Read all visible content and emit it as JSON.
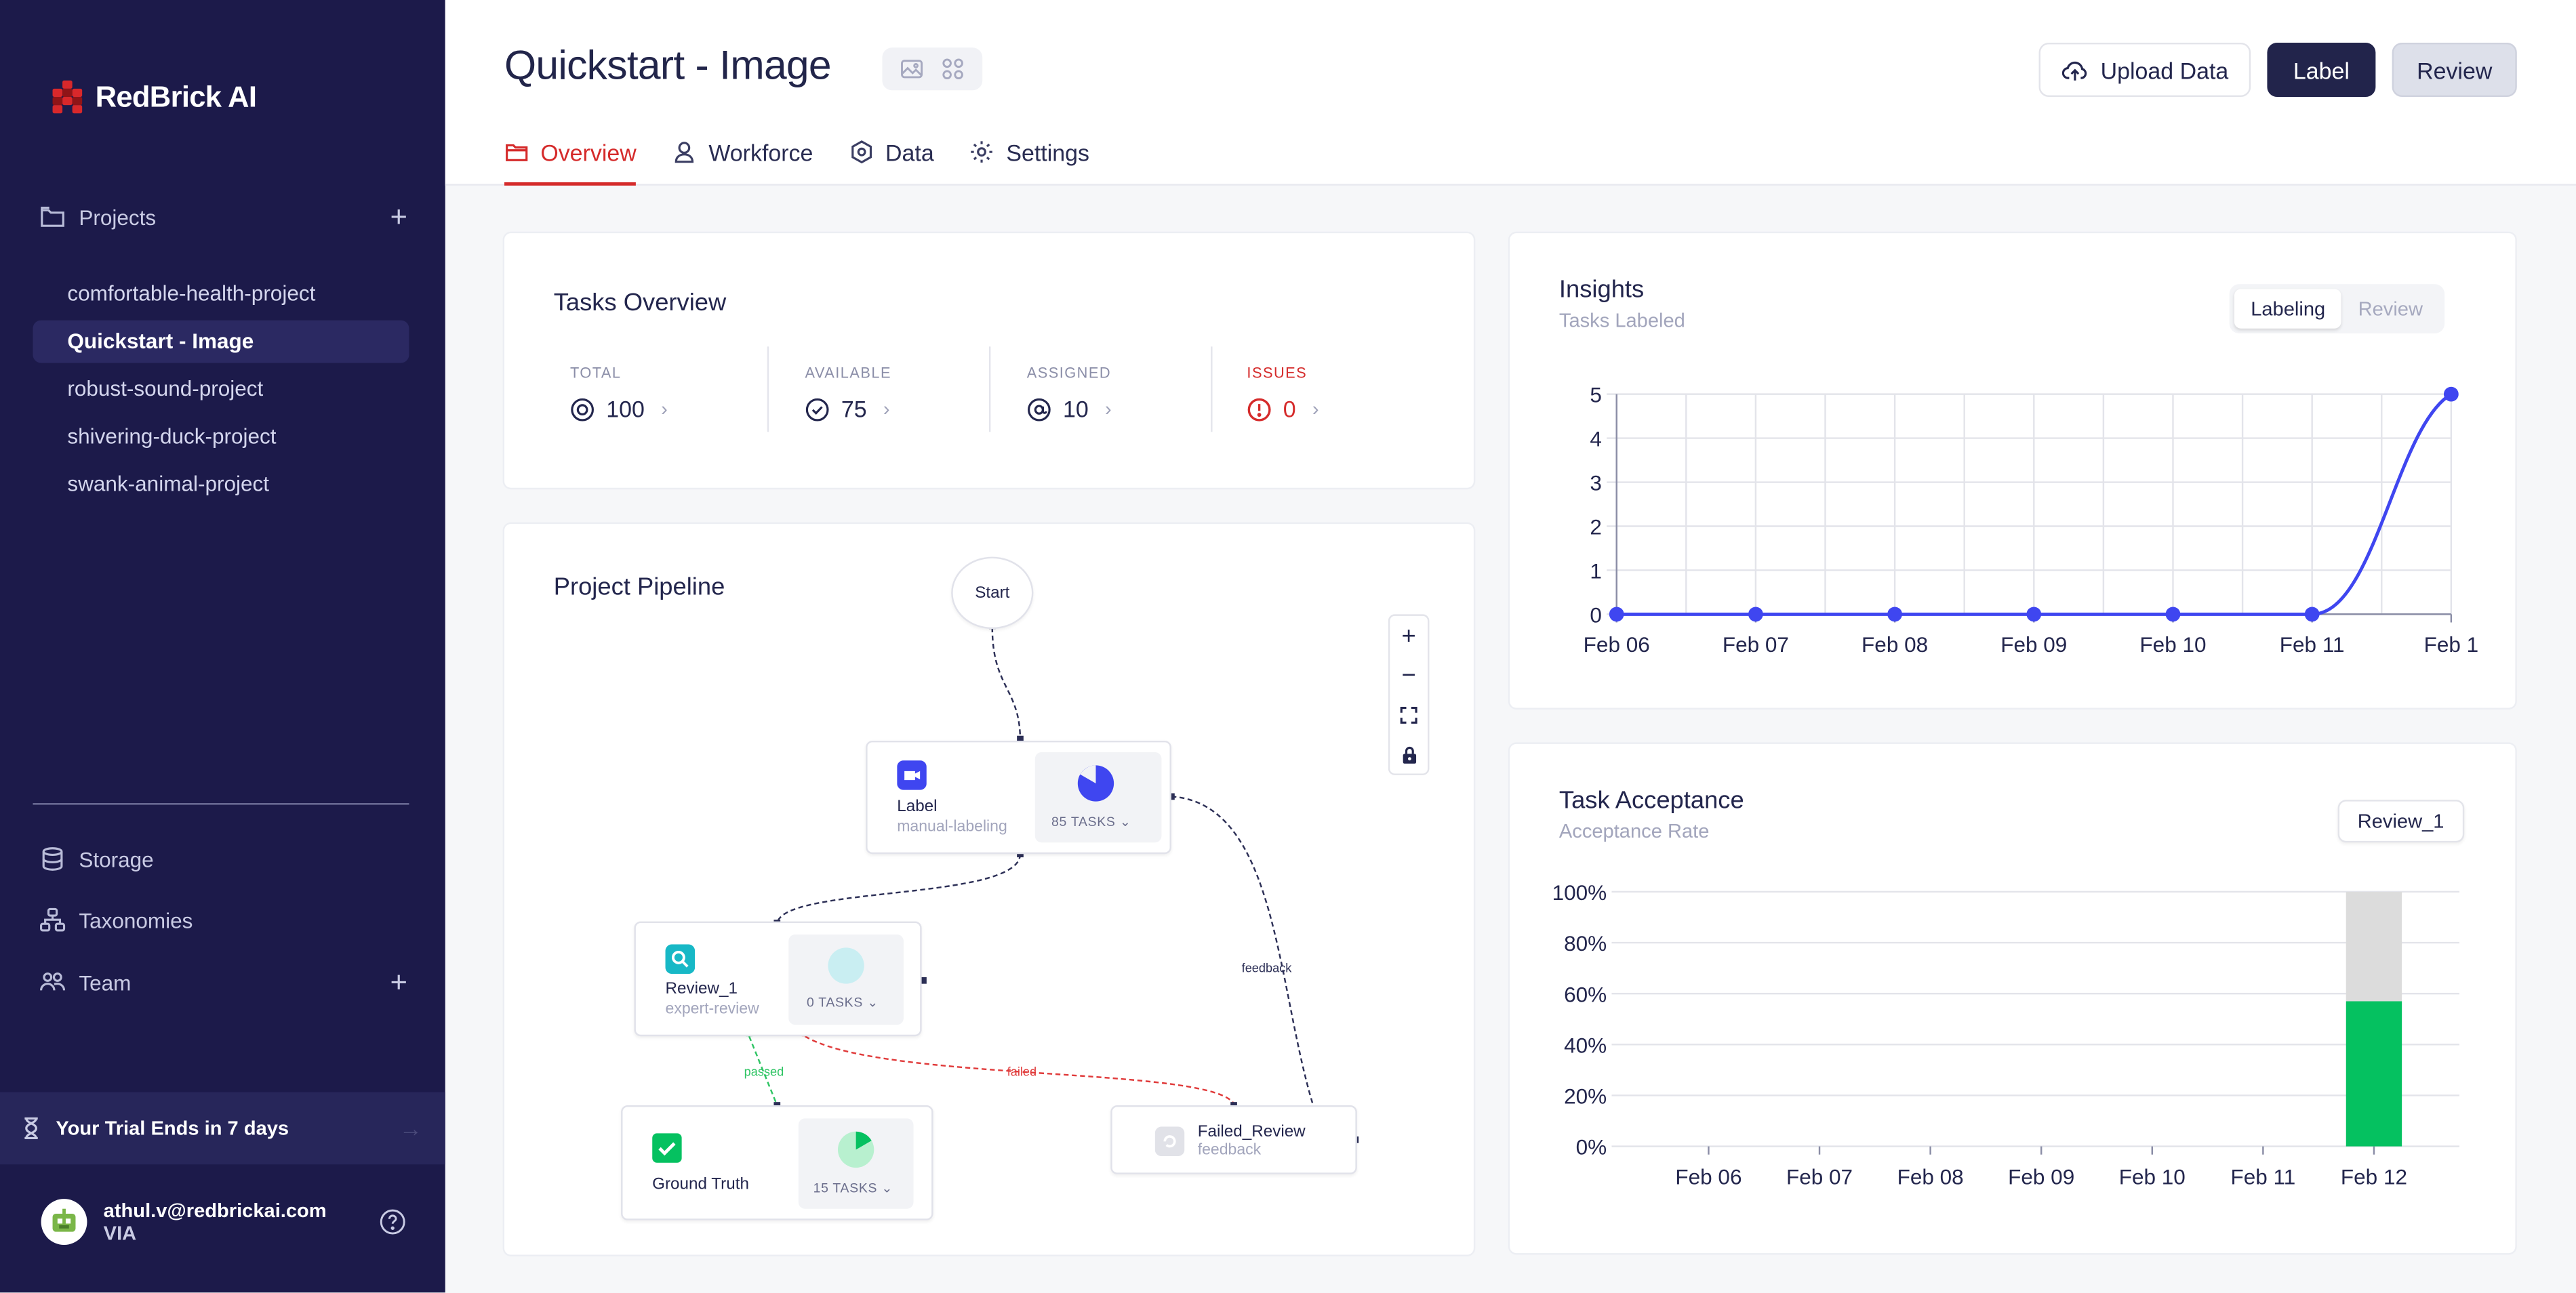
{
  "sidebar": {
    "brand": "RedBrick AI",
    "projects_label": "Projects",
    "projects": [
      {
        "label": "comfortable-health-project",
        "active": false
      },
      {
        "label": "Quickstart - Image",
        "active": true
      },
      {
        "label": "robust-sound-project",
        "active": false
      },
      {
        "label": "shivering-duck-project",
        "active": false
      },
      {
        "label": "swank-animal-project",
        "active": false
      }
    ],
    "storage_label": "Storage",
    "taxonomies_label": "Taxonomies",
    "team_label": "Team",
    "trial_label": "Your Trial Ends in 7 days",
    "user_email": "athul.v@redbrickai.com",
    "user_org": "VIA"
  },
  "header": {
    "title": "Quickstart - Image",
    "upload_label": "Upload Data",
    "label_btn": "Label",
    "review_btn": "Review",
    "tabs": [
      {
        "label": "Overview",
        "active": true
      },
      {
        "label": "Workforce",
        "active": false
      },
      {
        "label": "Data",
        "active": false
      },
      {
        "label": "Settings",
        "active": false
      }
    ]
  },
  "tasks_overview": {
    "title": "Tasks Overview",
    "stats": [
      {
        "label": "TOTAL",
        "value": "100"
      },
      {
        "label": "AVAILABLE",
        "value": "75"
      },
      {
        "label": "ASSIGNED",
        "value": "10"
      },
      {
        "label": "ISSUES",
        "value": "0"
      }
    ]
  },
  "pipeline": {
    "title": "Project Pipeline",
    "start_label": "Start",
    "nodes": {
      "label": {
        "title": "Label",
        "sub": "manual-labeling",
        "tasks": "85 TASKS"
      },
      "review": {
        "title": "Review_1",
        "sub": "expert-review",
        "tasks": "0 TASKS"
      },
      "ground_truth": {
        "title": "Ground Truth",
        "tasks": "15 TASKS"
      },
      "failed_review": {
        "title": "Failed_Review",
        "sub": "feedback"
      }
    },
    "edge_labels": {
      "passed": "passed",
      "failed": "failed",
      "feedback": "feedback"
    },
    "zoom_controls": [
      "+",
      "−"
    ]
  },
  "insights": {
    "title": "Insights",
    "subtitle": "Tasks Labeled",
    "toggle": [
      "Labeling",
      "Review"
    ],
    "toggle_active": "Labeling"
  },
  "acceptance": {
    "title": "Task Acceptance",
    "subtitle": "Acceptance Rate",
    "dropdown_value": "Review_1"
  },
  "colors": {
    "sidebar_bg": "#1c1a4a",
    "accent_red": "#d52b2b",
    "line_blue": "#3f46f0",
    "accept_green": "#05c160",
    "reject_gray": "#dcdcdc"
  },
  "chart_data": [
    {
      "type": "line",
      "x": [
        "Feb 06",
        "Feb 07",
        "Feb 08",
        "Feb 09",
        "Feb 10",
        "Feb 11",
        "Feb 1"
      ],
      "series": [
        {
          "values": [
            0,
            0,
            0,
            0,
            0,
            0,
            5
          ]
        }
      ],
      "yticks": [
        "0",
        "1",
        "2",
        "3",
        "4",
        "5"
      ],
      "ylim": [
        0,
        5
      ],
      "grid": true
    },
    {
      "type": "bar",
      "categories": [
        "Feb 06",
        "Feb 07",
        "Feb 08",
        "Feb 09",
        "Feb 10",
        "Feb 11",
        "Feb 12"
      ],
      "series": [
        {
          "values": [
            0,
            0,
            0,
            0,
            0,
            0,
            57
          ]
        },
        {
          "values": [
            0,
            0,
            0,
            0,
            0,
            0,
            43
          ]
        }
      ],
      "yticks": [
        "0%",
        "20%",
        "40%",
        "60%",
        "80%",
        "100%"
      ],
      "ylim": [
        0,
        100
      ],
      "stacked": true,
      "grid": true
    }
  ]
}
